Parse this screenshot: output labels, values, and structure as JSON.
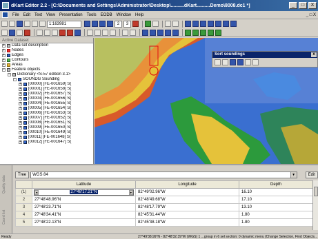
{
  "window": {
    "title": "dKart Editor 2.2 - [C:\\Documents and Settings\\Administrator\\Desktop\\..........dKart..........Demo\\8008.dc1 *]",
    "min": "_",
    "max": "□",
    "close": "X"
  },
  "menu": {
    "items": [
      "File",
      "Edit",
      "Text",
      "View",
      "Presentation",
      "Tools",
      "EODB",
      "Window",
      "Help"
    ],
    "doc_controls": "_ □ X"
  },
  "toolbar": {
    "scale_value": "1:163981",
    "page_numbers": [
      "2",
      "3"
    ]
  },
  "left_panel": {
    "header": "Active Dataset",
    "tree": [
      {
        "label": "Data set description",
        "indent": 0,
        "exp": "+",
        "icon": "grey",
        "icon_name": "document-icon"
      },
      {
        "label": "Nodes",
        "indent": 0,
        "exp": "+",
        "icon": "red",
        "icon_name": "node-icon"
      },
      {
        "label": "Edges",
        "indent": 0,
        "exp": "+",
        "icon": "blue",
        "icon_name": "edge-icon"
      },
      {
        "label": "Contours",
        "indent": 0,
        "exp": "+",
        "icon": "green",
        "icon_name": "contour-icon"
      },
      {
        "label": "Areas",
        "indent": 0,
        "exp": "+",
        "icon": "gold",
        "icon_name": "area-icon"
      },
      {
        "label": "Feature objects",
        "indent": 0,
        "exp": "−",
        "icon": "grey",
        "icon_name": "feature-icon"
      },
      {
        "label": "Dictionary <S-57 edition 3.1>",
        "indent": 1,
        "exp": "−",
        "icon": "grey",
        "icon_name": "dictionary-icon"
      },
      {
        "label": "SOUNDG Sounding",
        "indent": 2,
        "exp": "−",
        "icon": "blue",
        "icon_name": "sounding-icon"
      },
      {
        "label": "[00000] [FE-001659] S(",
        "indent": 3,
        "exp": "+",
        "icon": "blue",
        "icon_name": "sounding-icon"
      },
      {
        "label": "[00001] [FE-001658] S(",
        "indent": 3,
        "exp": "+",
        "icon": "blue",
        "icon_name": "sounding-icon"
      },
      {
        "label": "[00002] [FE-001657] S(",
        "indent": 3,
        "exp": "+",
        "icon": "blue",
        "icon_name": "sounding-icon"
      },
      {
        "label": "[00003] [FE-001656] S(",
        "indent": 3,
        "exp": "+",
        "icon": "blue",
        "icon_name": "sounding-icon"
      },
      {
        "label": "[00004] [FE-001655] S(",
        "indent": 3,
        "exp": "+",
        "icon": "blue",
        "icon_name": "sounding-icon"
      },
      {
        "label": "[00005] [FE-001654] S(",
        "indent": 3,
        "exp": "+",
        "icon": "blue",
        "icon_name": "sounding-icon"
      },
      {
        "label": "[00006] [FE-001653] S(",
        "indent": 3,
        "exp": "+",
        "icon": "blue",
        "icon_name": "sounding-icon"
      },
      {
        "label": "[00007] [FE-001652] S(",
        "indent": 3,
        "exp": "+",
        "icon": "blue",
        "icon_name": "sounding-icon"
      },
      {
        "label": "[00008] [FE-001651] S(",
        "indent": 3,
        "exp": "+",
        "icon": "blue",
        "icon_name": "sounding-icon"
      },
      {
        "label": "[00009] [FE-001650] S(",
        "indent": 3,
        "exp": "+",
        "icon": "blue",
        "icon_name": "sounding-icon"
      },
      {
        "label": "[00010] [FE-001649] S(",
        "indent": 3,
        "exp": "+",
        "icon": "blue",
        "icon_name": "sounding-icon"
      },
      {
        "label": "[00011] [FE-001648] S(",
        "indent": 3,
        "exp": "+",
        "icon": "blue",
        "icon_name": "sounding-icon"
      },
      {
        "label": "[00012] [FE-001647] S(",
        "indent": 3,
        "exp": "+",
        "icon": "blue",
        "icon_name": "sounding-icon"
      }
    ]
  },
  "sort_window": {
    "title": "Sort soundings",
    "close": "x"
  },
  "bottom": {
    "tree_button": "Tree",
    "crs": "WGS 84",
    "edit_button": "Edit",
    "side_tabs": [
      "Coord list",
      "Quality data"
    ],
    "columns": [
      "",
      "Latitude",
      "Longitude",
      "Depth"
    ],
    "rows": [
      {
        "n": "(1)",
        "lat": "27°48'17.21\"N",
        "lon": "82°49'02.96\"W",
        "depth": "16.10"
      },
      {
        "n": "2",
        "lat": "27°48'48.96\"N",
        "lon": "82°48'49.68\"W",
        "depth": "17.10"
      },
      {
        "n": "3",
        "lat": "27°48'23.71\"N",
        "lon": "82°48'17.79\"W",
        "depth": "13.10"
      },
      {
        "n": "4",
        "lat": "27°48'34.41\"N",
        "lon": "82°45'31.44\"W",
        "depth": "1.80"
      },
      {
        "n": "5",
        "lat": "27°48'22.13\"N",
        "lon": "82°45'38.18\"W",
        "depth": "1.80"
      }
    ]
  },
  "status": {
    "left": "Ready",
    "right": "27°49'38.99\"N - 82°48'32.39\"W (WGS)   1 ...group in 6 sel section: 0 dynamic menu (Change Selection, Find Objects..."
  }
}
